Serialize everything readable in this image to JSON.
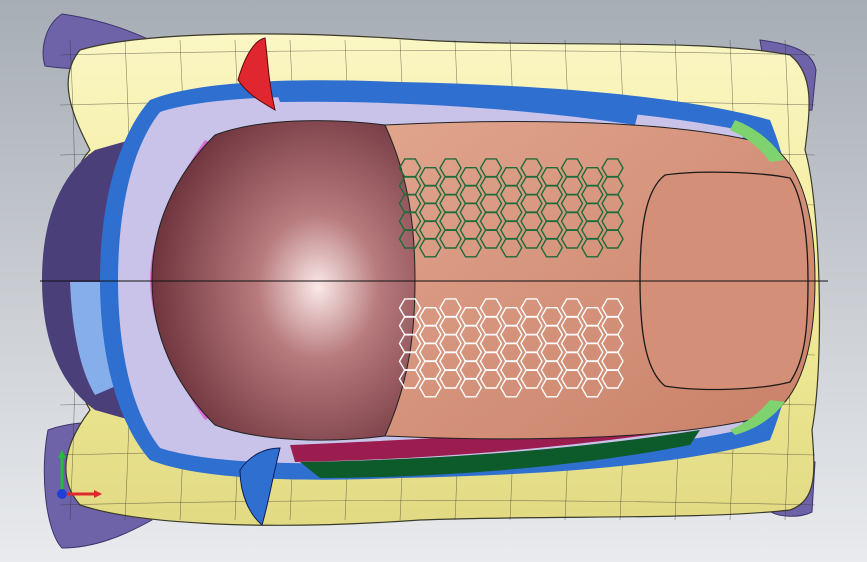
{
  "viewport": {
    "background_top": "#a7adb5",
    "background_bottom": "#e9ebee"
  },
  "model": {
    "colors": {
      "body_yellow": "#f2ec9a",
      "body_yellow_shade": "#d9d27a",
      "canopy_copper": "#d79a82",
      "canopy_dark": "#6a2f39",
      "canopy_highlight": "#fbe9e8",
      "hatch_panel": "#d48f78",
      "blue": "#2e6fd0",
      "blue_light": "#86aeea",
      "lavender": "#c9c3ea",
      "purple_dark": "#4b3f7a",
      "magenta": "#d76ad3",
      "red": "#e0262f",
      "green_dark": "#0d5b2a",
      "green_light": "#7ed36f",
      "crimson": "#9b1d4f",
      "tire_purple": "#6e63a8",
      "hex_green": "#1f6b3a",
      "hex_white": "#ffffff",
      "wire": "#2a2a2a"
    },
    "hex_grid_top": {
      "rows": 5,
      "cols": 11,
      "stroke_color": "#1f6b3a"
    },
    "hex_grid_bottom": {
      "rows": 5,
      "cols": 11,
      "stroke_color": "#ffffff"
    }
  },
  "triad": {
    "x_axis_color": "#e0262f",
    "y_axis_color": "#1fbf3a",
    "z_axis_color": "#1e40d8"
  }
}
